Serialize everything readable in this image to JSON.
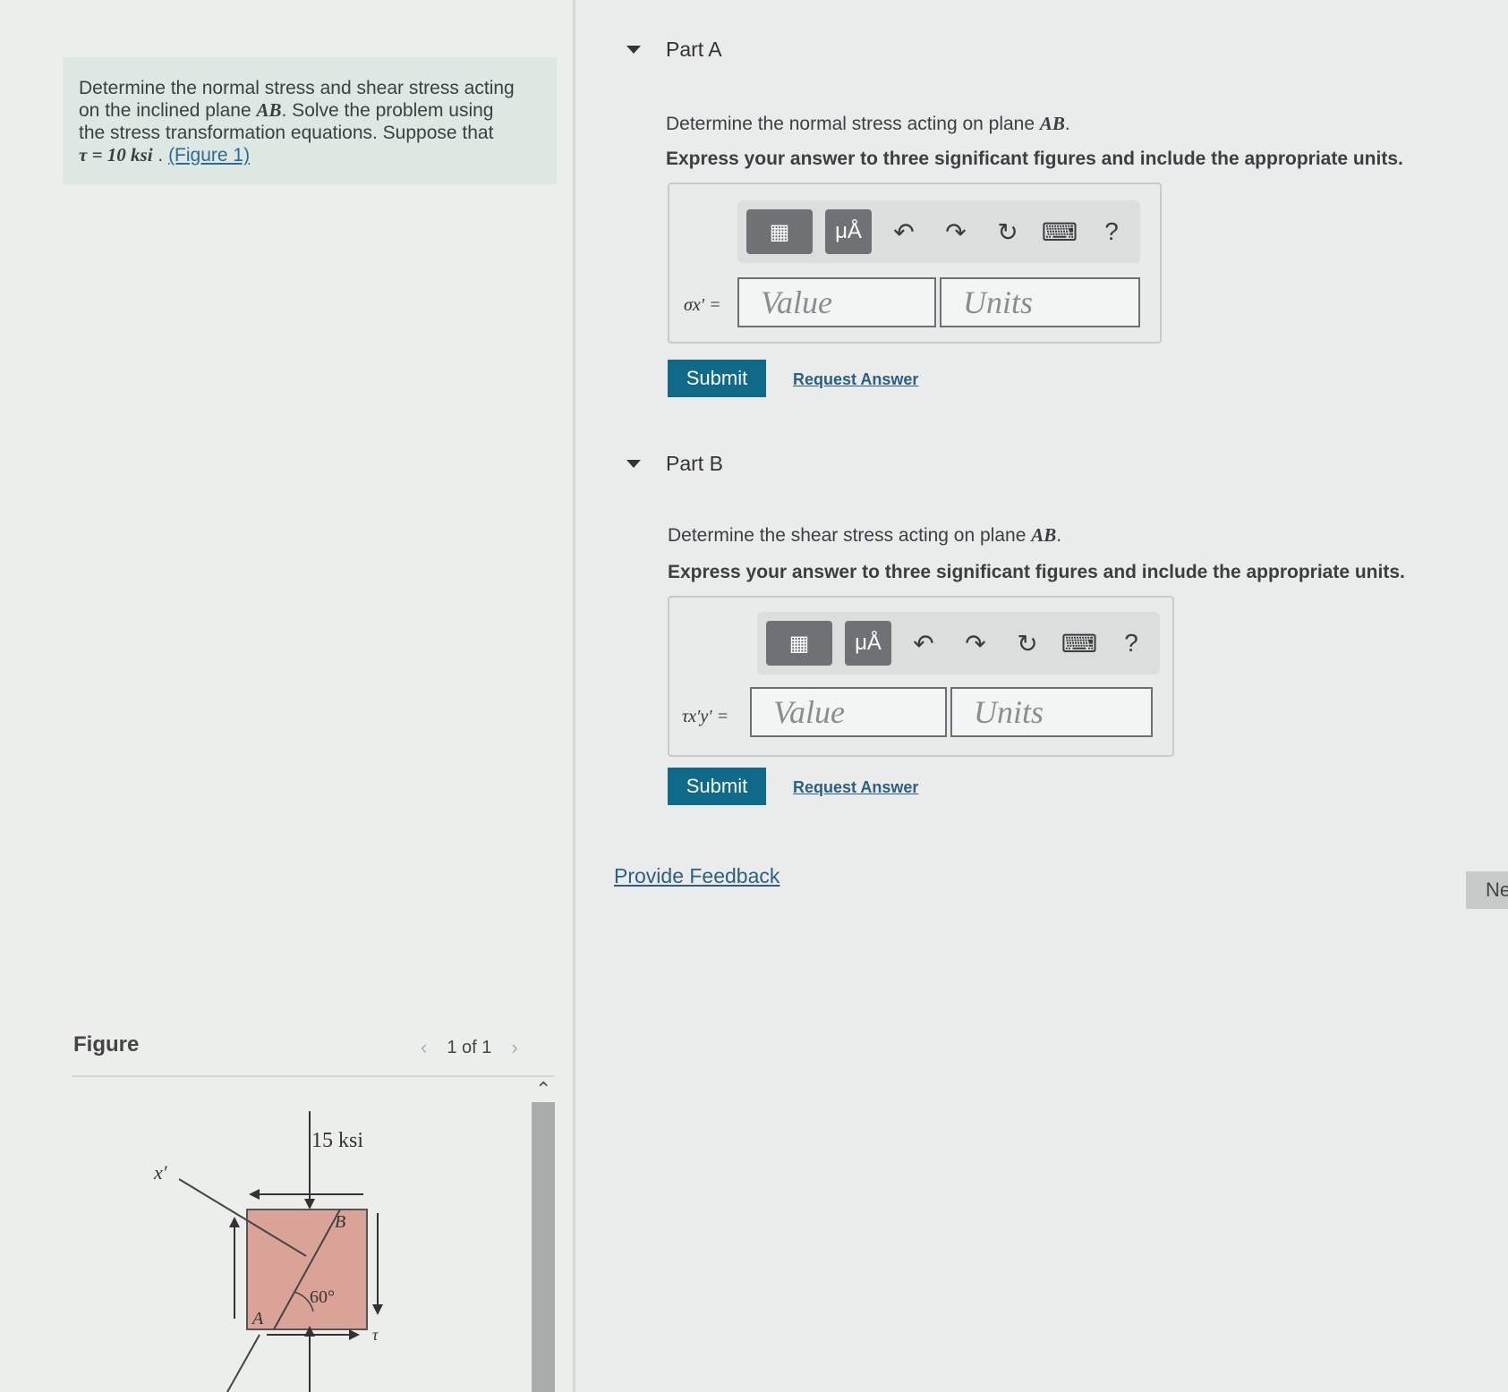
{
  "problem": {
    "text_line1": "Determine the normal stress and shear stress acting",
    "text_line2_pre": "on the inclined plane ",
    "text_line2_math": "AB",
    "text_line2_post": ". Solve the problem using",
    "text_line3": "the stress transformation equations. Suppose that",
    "tau_expr": "τ = 10 ksi",
    "figure_link": "(Figure 1)"
  },
  "figure": {
    "label": "Figure",
    "pager": "1 of 1",
    "prev_icon": "chevron-left-icon",
    "next_icon": "chevron-right-icon",
    "diagram": {
      "stress_label": "15 ksi",
      "axis_label": "x′",
      "point_b": "B",
      "point_a": "A",
      "angle": "60°",
      "shear_symbol": "τ"
    }
  },
  "toolbar": {
    "templates_icon": "template-icon",
    "units_label": "μÅ",
    "undo_icon": "undo-icon",
    "redo_icon": "redo-icon",
    "reset_icon": "reset-icon",
    "keyboard_icon": "keyboard-icon",
    "help_label": "?"
  },
  "partA": {
    "title": "Part A",
    "prompt_pre": "Determine the normal stress acting on plane ",
    "prompt_math": "AB",
    "prompt_post": ".",
    "instructions": "Express your answer to three significant figures and include the appropriate units.",
    "var_label": "σx′ =",
    "value_placeholder": "Value",
    "units_placeholder": "Units",
    "submit": "Submit",
    "request": "Request Answer"
  },
  "partB": {
    "title": "Part B",
    "prompt_pre": "Determine the shear stress acting on plane ",
    "prompt_math": "AB",
    "prompt_post": ".",
    "instructions": "Express your answer to three significant figures and include the appropriate units.",
    "var_label": "τx′y′ =",
    "value_placeholder": "Value",
    "units_placeholder": "Units",
    "submit": "Submit",
    "request": "Request Answer"
  },
  "feedback": "Provide Feedback",
  "next": "Ne",
  "colors": {
    "submit_bg": "#0f6a8a",
    "link": "#2d5e86",
    "block_fill": "#d9a497"
  }
}
